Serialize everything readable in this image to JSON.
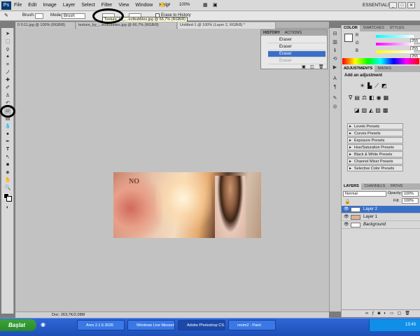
{
  "app": {
    "logo": "Ps",
    "zoom_display": "100%",
    "workspace": "ESSENTIALS",
    "window_buttons": [
      "_",
      "□",
      "✕"
    ]
  },
  "menu": [
    "File",
    "Edit",
    "Image",
    "Layer",
    "Select",
    "Filter",
    "View",
    "Window",
    "Help"
  ],
  "options_bar": {
    "tool_label": "Brush:",
    "mode_label": "Mode:",
    "mode_value": "Brush",
    "erase_to_history": "Erase to History"
  },
  "tooltip": "Texture_by_...ectbubbles.jpg @ 66,7% (RGB/8)",
  "document_tabs": [
    "0 0:11.jpg @ 100% (RGB/8)",
    "texture_by_...ectbubbles.jpg @ 66,7% (RGB/8)",
    "Untitled-1 @ 100% (Layer 2, RGB/8) *"
  ],
  "canvas": {
    "artwork_text": "NO"
  },
  "status_bar": {
    "text": "Doc: 263,7K/2,08M"
  },
  "history": {
    "tabs": [
      "HISTORY",
      "ACTIONS"
    ],
    "items": [
      {
        "label": "Eraser",
        "selected": false
      },
      {
        "label": "Eraser",
        "selected": false
      },
      {
        "label": "Eraser",
        "selected": true
      },
      {
        "label": "Eraser",
        "selected": false
      }
    ]
  },
  "color_panel": {
    "tabs": [
      "COLOR",
      "SWATCHES",
      "STYLES"
    ],
    "channels": [
      {
        "label": "R",
        "value": "255",
        "gradient": [
          "#00ffff",
          "#ffffff"
        ]
      },
      {
        "label": "G",
        "value": "255",
        "gradient": [
          "#ff00ff",
          "#ffffff"
        ]
      },
      {
        "label": "B",
        "value": "255",
        "gradient": [
          "#ffff00",
          "#ffffff"
        ]
      }
    ]
  },
  "adjustments": {
    "tabs": [
      "ADJUSTMENTS",
      "MASKS"
    ],
    "title": "Add an adjustment",
    "presets": [
      "Levels Presets",
      "Curves Presets",
      "Exposure Presets",
      "Hue/Saturation Presets",
      "Black & White Presets",
      "Channel Mixer Presets",
      "Selective Color Presets"
    ]
  },
  "layers": {
    "tabs": [
      "LAYERS",
      "CHANNELS",
      "PATHS"
    ],
    "blend_mode": "Normal",
    "opacity_label": "Opacity:",
    "opacity_value": "100%",
    "fill_label": "Fill:",
    "fill_value": "100%",
    "items": [
      {
        "name": "Layer 2",
        "selected": true
      },
      {
        "name": "Layer 1",
        "selected": false
      },
      {
        "name": "Background",
        "selected": false
      }
    ]
  },
  "taskbar": {
    "start_label": "Başlat",
    "tasks": [
      "Ares 2.1.5.3039",
      "Windows Live Messen...",
      "Adobe Photoshop CS...",
      "resim2 - Paint"
    ],
    "clock": "13:43"
  }
}
